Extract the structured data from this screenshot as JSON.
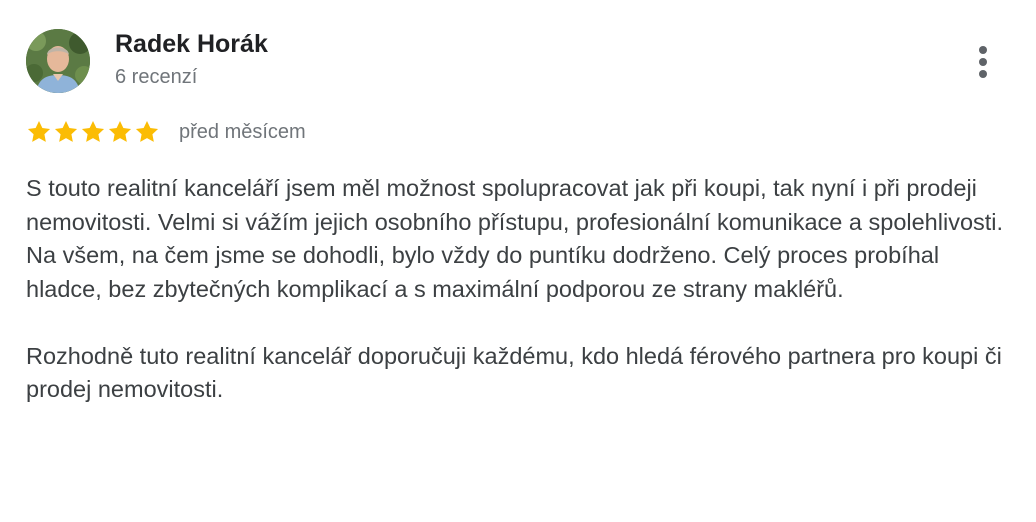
{
  "author": {
    "name": "Radek Horák",
    "review_count": "6 recenzí"
  },
  "rating": {
    "stars": 5,
    "max_stars": 5,
    "star_color": "#fbbc04"
  },
  "review": {
    "date": "před měsícem",
    "paragraphs": [
      "S touto realitní kanceláří jsem měl možnost spolupracovat jak při koupi, tak nyní i při prodeji nemovitosti. Velmi si vážím jejich osobního přístupu, profesionální komunikace a spolehlivosti. Na všem, na čem jsme se dohodli, bylo vždy do puntíku dodrženo. Celý proces probíhal hladce, bez zbytečných komplikací a s maximální podporou ze strany makléřů.",
      "Rozhodně tuto realitní kancelář doporučuji každému, kdo hledá férového partnera pro koupi či prodej nemovitosti."
    ]
  },
  "icons": {
    "more": "more-vertical-icon",
    "star": "star-icon"
  }
}
